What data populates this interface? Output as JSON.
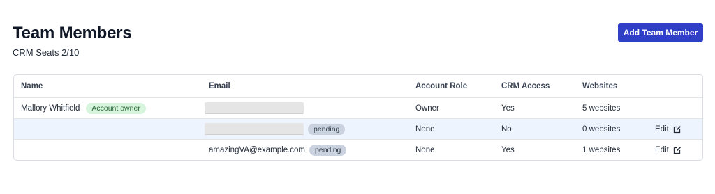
{
  "header": {
    "title": "Team Members",
    "seats": "CRM Seats 2/10",
    "add_button": "Add Team Member"
  },
  "table": {
    "columns": [
      "Name",
      "Email",
      "Account Role",
      "CRM Access",
      "Websites"
    ],
    "rows": [
      {
        "name": "Mallory Whitfield",
        "badge": "Account owner",
        "email": "",
        "email_redacted": true,
        "status": "",
        "role": "Owner",
        "crm": "Yes",
        "websites": "5 websites",
        "edit": ""
      },
      {
        "name": "",
        "badge": "",
        "email": "",
        "email_redacted": true,
        "status": "pending",
        "role": "None",
        "crm": "No",
        "websites": "0 websites",
        "edit": "Edit"
      },
      {
        "name": "",
        "badge": "",
        "email": "amazingVA@example.com",
        "email_redacted": false,
        "status": "pending",
        "role": "None",
        "crm": "Yes",
        "websites": "1 websites",
        "edit": "Edit"
      }
    ]
  },
  "colors": {
    "primary_button": "#2f3fc7",
    "owner_badge_bg": "#d6f5dc",
    "pending_badge_bg": "#c9d2de",
    "selected_row_bg": "#eef4fd"
  },
  "icons": {
    "edit": "edit-icon"
  }
}
